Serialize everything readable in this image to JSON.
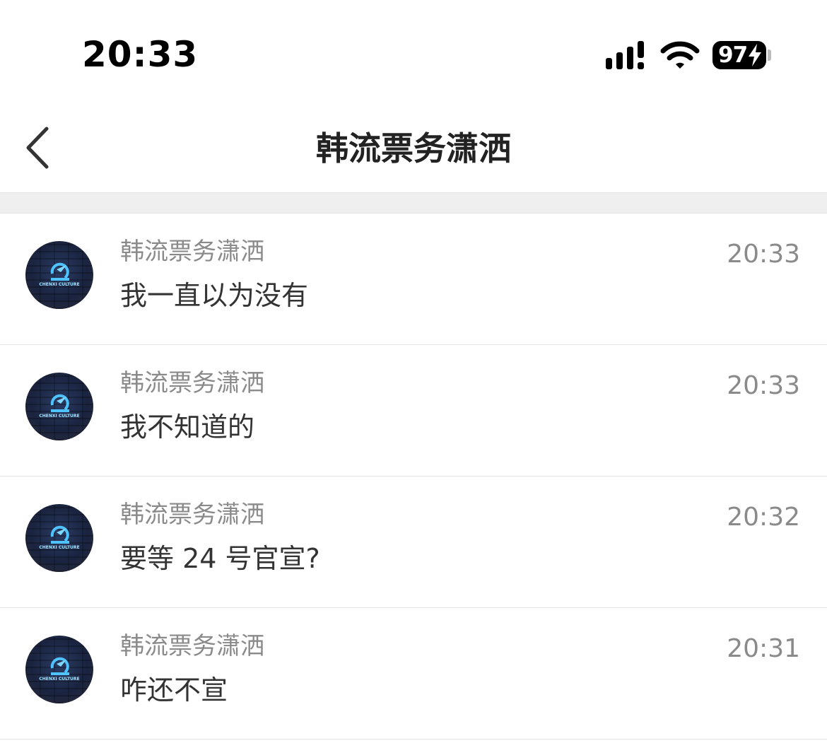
{
  "status_bar": {
    "time": "20:33",
    "battery": "97",
    "icons": [
      "signal-icon",
      "wifi-icon",
      "battery-charging-icon"
    ]
  },
  "nav": {
    "title": "韩流票务潇洒",
    "back_icon": "chevron-left-icon"
  },
  "messages": [
    {
      "sender": "韩流票务潇洒",
      "text": "我一直以为没有",
      "time": "20:33",
      "avatar_label": "CHENXI CULTURE"
    },
    {
      "sender": "韩流票务潇洒",
      "text": "我不知道的",
      "time": "20:33",
      "avatar_label": "CHENXI CULTURE"
    },
    {
      "sender": "韩流票务潇洒",
      "text": "要等 24 号官宣?",
      "time": "20:32",
      "avatar_label": "CHENXI CULTURE"
    },
    {
      "sender": "韩流票务潇洒",
      "text": "咋还不宣",
      "time": "20:31",
      "avatar_label": "CHENXI CULTURE"
    }
  ]
}
